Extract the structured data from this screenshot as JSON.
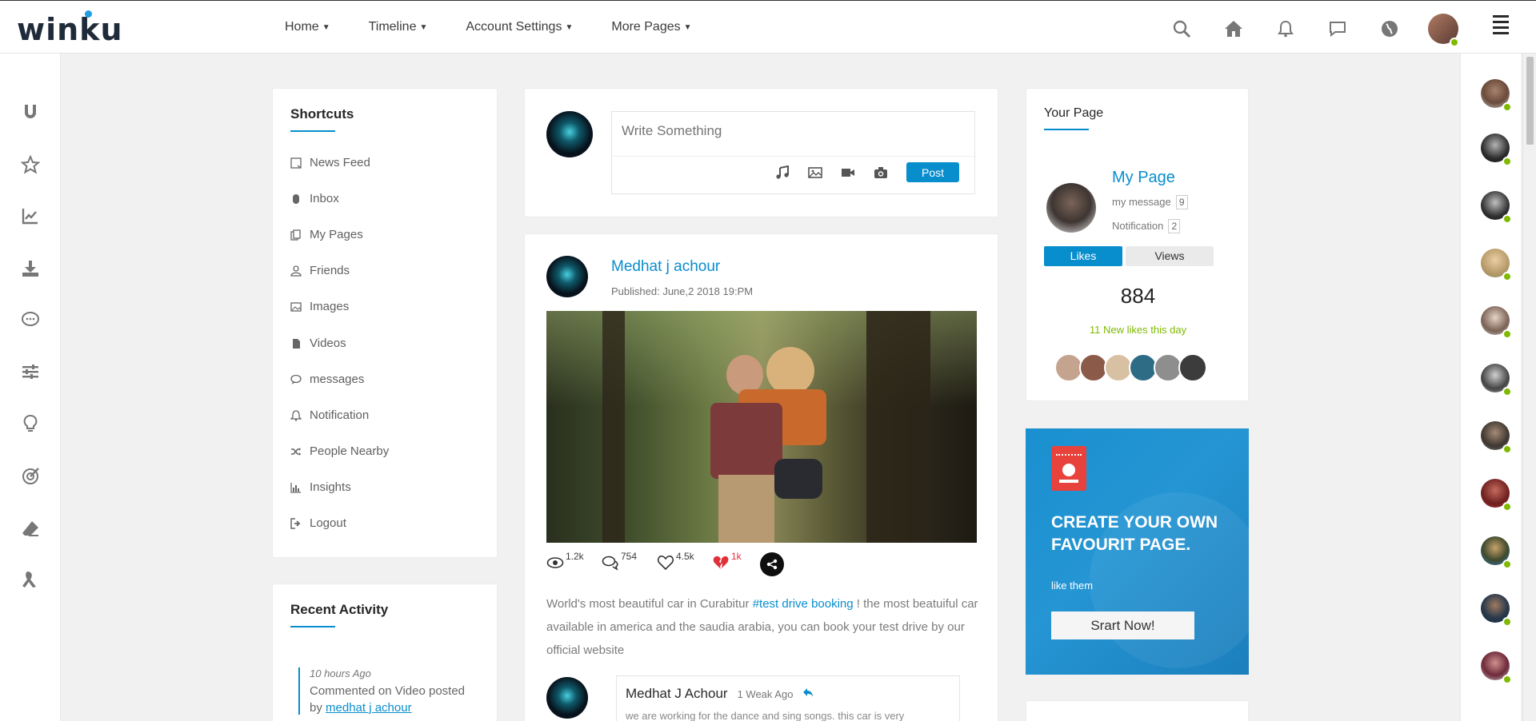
{
  "brand": {
    "logo_text": "winku",
    "accent": "#088dcd"
  },
  "nav": {
    "items": [
      {
        "label": "Home"
      },
      {
        "label": "Timeline"
      },
      {
        "label": "Account Settings"
      },
      {
        "label": "More Pages"
      }
    ]
  },
  "top_icons": [
    "search-icon",
    "home-icon",
    "bell-icon",
    "chat-icon",
    "globe-icon"
  ],
  "left_icons": [
    "magnet-icon",
    "star-icon",
    "chart-icon",
    "download-icon",
    "comments-icon",
    "sliders-icon",
    "lightbulb-icon",
    "target-icon",
    "eraser-icon",
    "ribbon-icon"
  ],
  "shortcuts": {
    "title": "Shortcuts",
    "items": [
      {
        "label": "News Feed",
        "icon": "newspaper-icon"
      },
      {
        "label": "Inbox",
        "icon": "mouse-icon"
      },
      {
        "label": "My Pages",
        "icon": "files-icon"
      },
      {
        "label": "Friends",
        "icon": "user-icon"
      },
      {
        "label": "Images",
        "icon": "image-icon"
      },
      {
        "label": "Videos",
        "icon": "file-icon"
      },
      {
        "label": "messages",
        "icon": "message-icon"
      },
      {
        "label": "Notification",
        "icon": "bell-icon"
      },
      {
        "label": "People Nearby",
        "icon": "shuffle-icon"
      },
      {
        "label": "Insights",
        "icon": "bar-chart-icon"
      },
      {
        "label": "Logout",
        "icon": "logout-icon"
      }
    ]
  },
  "recent_activity": {
    "title": "Recent Activity",
    "time": "10 hours Ago",
    "text": "Commented on Video posted",
    "by": "by",
    "link": "medhat j achour"
  },
  "composer": {
    "placeholder": "Write Something",
    "post_label": "Post"
  },
  "post": {
    "author": "Medhat j achour",
    "published": "Published: June,2 2018 19:PM",
    "stats": {
      "views": "1.2k",
      "comments": "754",
      "likes": "4.5k",
      "dislikes": "1k"
    },
    "text_before": "World's most beautiful car in Curabitur ",
    "hashtag": "#test drive booking",
    "text_after": " ! the most beatuiful car available in america and the saudia arabia, you can book your test drive by our official website"
  },
  "comment": {
    "author": "Medhat J Achour",
    "time": "1 Weak Ago",
    "text": "we are working for the dance and sing songs. this car is very"
  },
  "your_page": {
    "title": "Your Page",
    "name": "My Page",
    "message_label": "my message",
    "message_count": "9",
    "notification_label": "Notification",
    "notification_count": "2",
    "tab_likes": "Likes",
    "tab_views": "Views",
    "likes_count": "884",
    "new_likes": "11 New likes this day",
    "new_likes_color": "#7fba00"
  },
  "ad": {
    "title": "CREATE YOUR OWN FAVOURIT PAGE.",
    "subtitle": "like them",
    "button": "Srart Now!"
  },
  "friends": {
    "count": 11,
    "online_color": "#7fba00"
  }
}
